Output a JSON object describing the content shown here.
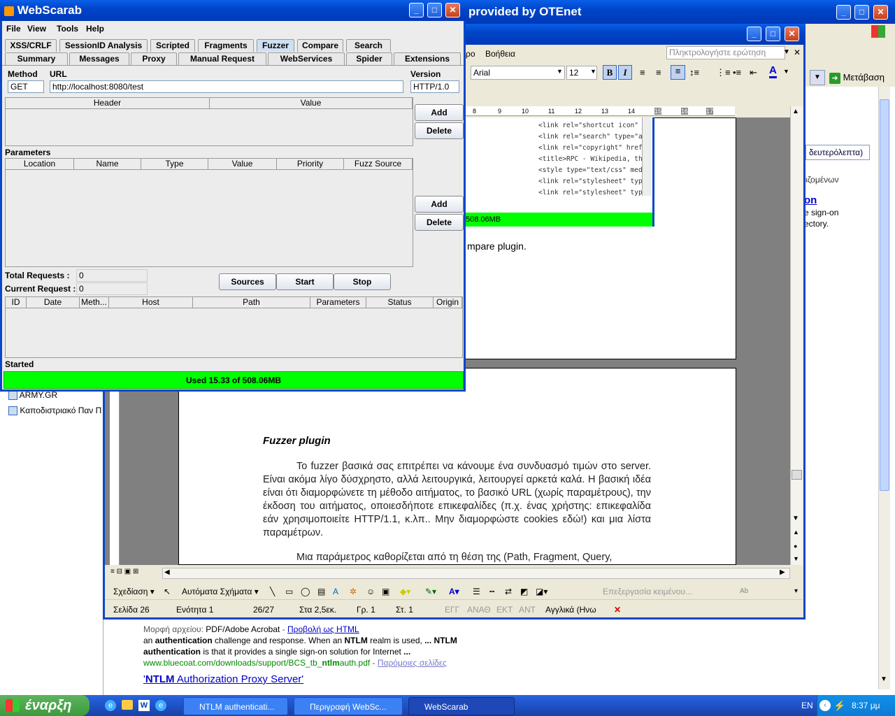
{
  "desktop": {
    "ie_title": "provided by OTEnet",
    "ie_go_label": "Μετάβαση",
    "ie_side_texts": [
      "δευτερόλεπτα)",
      "ιζομένων",
      "on",
      "e sign-on",
      "ectory."
    ],
    "favorites": [
      "ARMY.GR",
      "Καποδιστριακό Παν Π"
    ],
    "search_result": {
      "format_label": "Μορφή αρχείου:",
      "format_value": "PDF/Adobe Acrobat",
      "format_sep": " - ",
      "html_view": "Προβολή ως HTML",
      "line_pre": "an ",
      "line_b1": "authentication",
      "line_mid": " challenge and response. When an ",
      "line_b2": "NTLM",
      "line_mid2": " realm is used, ",
      "line_b3": "... NTLM",
      "line2_b": "authentication",
      "line2_rest": " is that it provides a single sign-on solution for Internet ",
      "line2_end": "...",
      "url_pre": "www.bluecoat.com/downloads/support/BCS_tb_",
      "url_b": "ntlm",
      "url_post": "auth.pdf",
      "url_sep": " - ",
      "similar": "Παρόμοιες σελίδες",
      "next_title_pre": "'",
      "next_title_b": "NTLM",
      "next_title_post": " Authorization Proxy Server'"
    }
  },
  "word": {
    "menu_help": "Βοήθεια",
    "menu_partial": "ρο",
    "ask_placeholder": "Πληκτρολογήστε ερώτηση",
    "font": "Arial",
    "size": "12",
    "ruler": [
      "8",
      "9",
      "10",
      "11",
      "12",
      "13",
      "14",
      "15",
      "16",
      "17"
    ],
    "code_lines": [
      "<link rel=\"shortcut icon\"",
      "<link rel=\"search\" type=\"a",
      "<link rel=\"copyright\" href",
      "<title>RPC - Wikipedia, th",
      "<style type=\"text/css\" med",
      "<link rel=\"stylesheet\" typ",
      "<link rel=\"stylesheet\" typ"
    ],
    "green_bar": "508.06MB",
    "compare_text": "mpare plugin.",
    "heading": "Fuzzer plugin",
    "para1": "Το fuzzer βασικά σας επιτρέπει να κάνουμε ένα συνδυασμό τιμών στο server. Είναι ακόμα λίγο δύσχρηστο, αλλά λειτουργικά, λειτουργεί αρκετά καλά. Η βασική ιδέα είναι ότι διαμορφώνετε τη μέθοδο αιτήματος, το βασικό URL (χωρίς παραμέτρους), την έκδοση του αιτήματος, οποιεσδήποτε επικεφαλίδες (π.χ.  ένας χρήστης: επικεφαλίδα εάν χρησιμοποιείτε HTTP/1.1, κ.λπ.. Μην διαμορφώστε cookies εδώ!) και μια λίστα παραμέτρων.",
    "para2": "Μια παράμετρος καθορίζεται από τη θέση της (Path, Fragment, Query,",
    "draw_label": "Σχεδίαση",
    "autoshapes_label": "Αυτόματα Σχήματα",
    "textedit_label": "Επεξεργασία κειμένου...",
    "status": {
      "page": "Σελίδα 26",
      "section": "Ενότητα 1",
      "pages": "26/27",
      "at": "Στα 2,5εκ.",
      "line": "Γρ. 1",
      "col": "Στ. 1",
      "rec": "ΕΓΓ",
      "trk": "ΑΝΑΘ",
      "ext": "ΕΚΤ",
      "ovr": "ΑΝΤ",
      "lang": "Αγγλικά (Ηνω"
    }
  },
  "webscarab": {
    "title": "WebScarab",
    "menu": [
      "File",
      "View",
      "Tools",
      "Help"
    ],
    "tabs_row1": [
      "XSS/CRLF",
      "SessionID Analysis",
      "Scripted",
      "Fragments",
      "Fuzzer",
      "Compare",
      "Search"
    ],
    "tabs_row2": [
      "Summary",
      "Messages",
      "Proxy",
      "Manual Request",
      "WebServices",
      "Spider",
      "Extensions"
    ],
    "method_label": "Method",
    "url_label": "URL",
    "version_label": "Version",
    "method": "GET",
    "url": "http://localhost:8080/test",
    "version": "HTTP/1.0",
    "header_cols": [
      "Header",
      "Value"
    ],
    "add_label": "Add",
    "delete_label": "Delete",
    "params_label": "Parameters",
    "param_cols": [
      "Location",
      "Name",
      "Type",
      "Value",
      "Priority",
      "Fuzz Source"
    ],
    "total_label": "Total Requests :",
    "total_value": "0",
    "current_label": "Current Request :",
    "current_value": "0",
    "sources_label": "Sources",
    "start_label": "Start",
    "stop_label": "Stop",
    "result_cols": [
      "ID",
      "Date",
      "Meth...",
      "Host",
      "Path",
      "Parameters",
      "Status",
      "Origin"
    ],
    "status": "Started",
    "memory": "Used 15.33 of 508.06MB"
  },
  "taskbar": {
    "start": "έναρξη",
    "tasks": [
      "NTLM authenticati...",
      "Περιγραφή WebSc...",
      "WebScarab"
    ],
    "lang": "EN",
    "time": "8:37 μμ"
  },
  "colors": {
    "xp_blue": "#0054e3",
    "taskbar": "#245edb",
    "start_green": "#3c9a3c",
    "memory_green": "#00ff00",
    "panel_gray": "#ececec",
    "word_gray": "#808080"
  }
}
